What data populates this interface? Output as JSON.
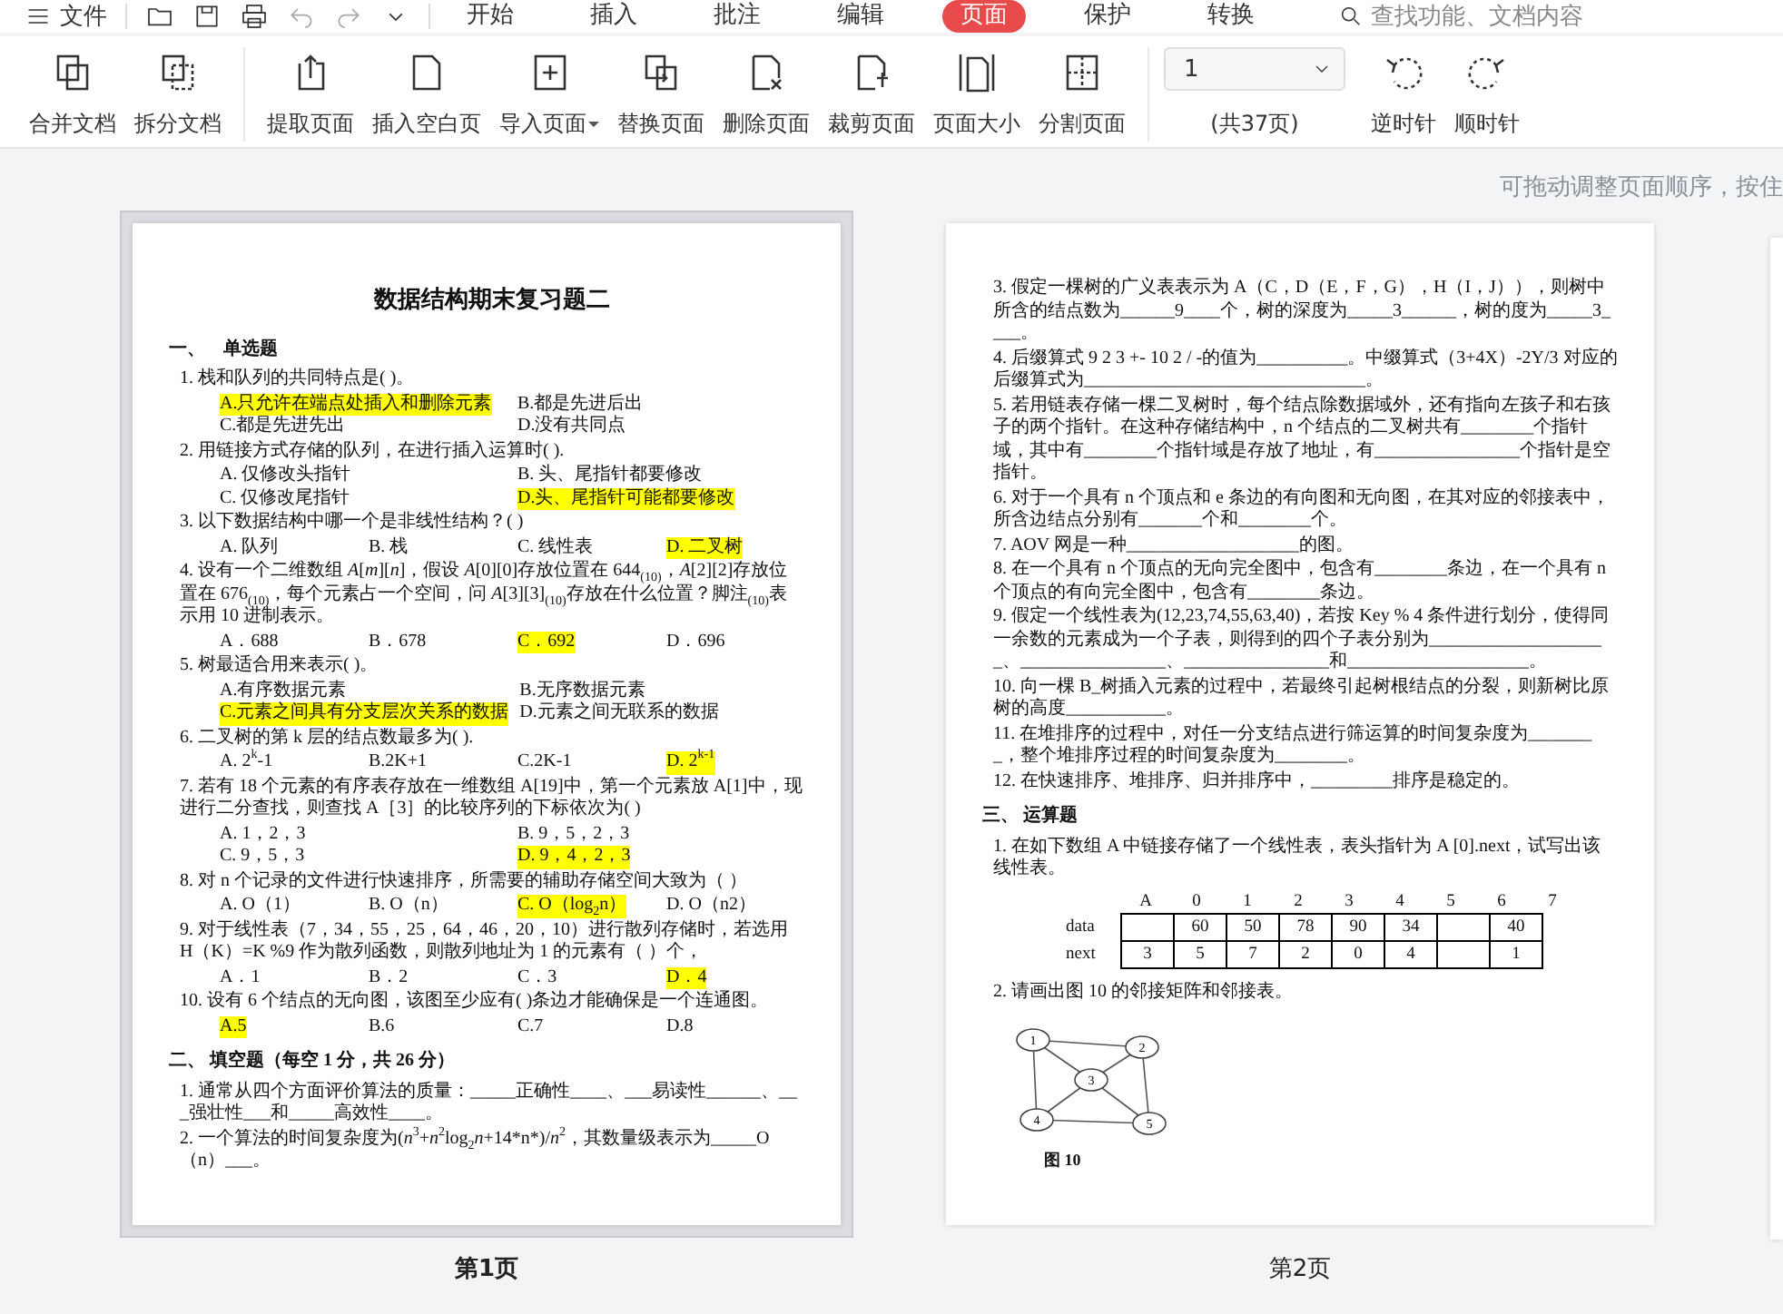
{
  "menu": {
    "label": "文件"
  },
  "tabs": [
    {
      "label": "开始",
      "selected": false
    },
    {
      "label": "插入",
      "selected": false
    },
    {
      "label": "批注",
      "selected": false
    },
    {
      "label": "编辑",
      "selected": false
    },
    {
      "label": "页面",
      "selected": true
    },
    {
      "label": "保护",
      "selected": false
    },
    {
      "label": "转换",
      "selected": false
    }
  ],
  "search": {
    "placeholder": "查找功能、文档内容"
  },
  "toolbar": {
    "groups": [
      [
        {
          "label": "合并文档",
          "dropdown": false
        },
        {
          "label": "拆分文档",
          "dropdown": false
        }
      ],
      [
        {
          "label": "提取页面",
          "dropdown": false
        },
        {
          "label": "插入空白页",
          "dropdown": false
        },
        {
          "label": "导入页面",
          "dropdown": true
        },
        {
          "label": "替换页面",
          "dropdown": false
        },
        {
          "label": "删除页面",
          "dropdown": false
        },
        {
          "label": "裁剪页面",
          "dropdown": false
        },
        {
          "label": "页面大小",
          "dropdown": false
        },
        {
          "label": "分割页面",
          "dropdown": false
        }
      ]
    ],
    "page_select": {
      "value": "1",
      "total": "(共37页)"
    },
    "rotate": [
      {
        "label": "逆时针"
      },
      {
        "label": "顺时针"
      }
    ]
  },
  "hint": "可拖动调整页面顺序，按住",
  "pages": [
    {
      "label": "第1页",
      "selected": true,
      "content": [
        {
          "kind": "title",
          "text": "数据结构期末复习题二"
        },
        {
          "kind": "section",
          "text": "一、　单选题"
        },
        {
          "kind": "question",
          "text": "1.  栈和队列的共同特点是(          )。"
        },
        {
          "kind": "options",
          "options": [
            {
              "text": "A.只允许在端点处插入和删除元素",
              "highlighted": true
            },
            {
              "text": "B.都是先进后出",
              "highlighted": false
            },
            {
              "text": "C.都是先进先出",
              "highlighted": false
            },
            {
              "text": "D.没有共同点",
              "highlighted": false
            }
          ]
        },
        {
          "kind": "question",
          "text": "2.  用链接方式存储的队列，在进行插入运算时(    )."
        },
        {
          "kind": "options",
          "options": [
            {
              "text": "A. 仅修改头指针",
              "highlighted": false
            },
            {
              "text": "B. 头、尾指针都要修改",
              "highlighted": false
            },
            {
              "text": "C. 仅修改尾指针",
              "highlighted": false
            },
            {
              "text": "D.头、尾指针可能都要修改",
              "highlighted": true
            }
          ]
        },
        {
          "kind": "question",
          "text": "3.  以下数据结构中哪一个是非线性结构？(     )"
        },
        {
          "kind": "options4",
          "options": [
            {
              "text": "A. 队列",
              "highlighted": false
            },
            {
              "text": "B. 栈",
              "highlighted": false
            },
            {
              "text": "C. 线性表",
              "highlighted": false
            },
            {
              "text": "D. 二叉树",
              "highlighted": true
            }
          ]
        },
        {
          "kind": "question",
          "text": "4.  设有一个二维数组 *A*[*m*][*n*]，假设 *A*[0][0]存放位置在 644$_{(10)}$，*A*[2][2]存放位置在 676$_{(10)}$，每个元素占一个空间，问 *A*[3][3]$_{(10)}$存放在什么位置？脚注$_{(10)}$表示用 10 进制表示。"
        },
        {
          "kind": "options4",
          "options": [
            {
              "text": "A．688",
              "highlighted": false
            },
            {
              "text": "B．678",
              "highlighted": false
            },
            {
              "text": "C．692",
              "highlighted": true
            },
            {
              "text": "D．696",
              "highlighted": false
            }
          ]
        },
        {
          "kind": "question",
          "text": "5.  树最适合用来表示(          )。"
        },
        {
          "kind": "options",
          "options": [
            {
              "text": "A.有序数据元素",
              "highlighted": false
            },
            {
              "text": "B.无序数据元素",
              "highlighted": false
            },
            {
              "text": "C.元素之间具有分支层次关系的数据",
              "highlighted": true
            },
            {
              "text": "D.元素之间无联系的数据",
              "highlighted": false
            }
          ]
        },
        {
          "kind": "question",
          "text": "6.  二叉树的第 k 层的结点数最多为(    )."
        },
        {
          "kind": "options4",
          "options": [
            {
              "text": "A.  2$^{k}$-1",
              "highlighted": false
            },
            {
              "text": "B.2K+1",
              "highlighted": false
            },
            {
              "text": "C.2K-1",
              "highlighted": false
            },
            {
              "text": "D. 2$^{k-1}$",
              "highlighted": true
            }
          ]
        },
        {
          "kind": "question",
          "text": "7.  若有 18 个元素的有序表存放在一维数组 A[19]中，第一个元素放 A[1]中，现进行二分查找，则查找 A［3］的比较序列的下标依次为(          )"
        },
        {
          "kind": "options",
          "options": [
            {
              "text": "A. 1，2，3",
              "highlighted": false
            },
            {
              "text": "B. 9，5，2，3",
              "highlighted": false
            },
            {
              "text": "C. 9，5，3",
              "highlighted": false
            },
            {
              "text": "D. 9，4，2，3",
              "highlighted": true
            }
          ]
        },
        {
          "kind": "question",
          "text": "8.  对 n 个记录的文件进行快速排序，所需要的辅助存储空间大致为（          ）"
        },
        {
          "kind": "options4",
          "options": [
            {
              "text": "A. O（1）",
              "highlighted": false
            },
            {
              "text": "B. O（n）",
              "highlighted": false
            },
            {
              "text": "C. O（log$_{2}$n）",
              "highlighted": true
            },
            {
              "text": "D. O（n2）",
              "highlighted": false
            }
          ]
        },
        {
          "kind": "question",
          "text": "9.  对于线性表（7，34，55，25，64，46，20，10）进行散列存储时，若选用 H（K）=K %9 作为散列函数，则散列地址为 1 的元素有（     ）个，"
        },
        {
          "kind": "options4",
          "options": [
            {
              "text": "A．1",
              "highlighted": false
            },
            {
              "text": "B．2",
              "highlighted": false
            },
            {
              "text": "C．3",
              "highlighted": false
            },
            {
              "text": "D．4",
              "highlighted": true
            }
          ]
        },
        {
          "kind": "question",
          "text": "10. 设有 6 个结点的无向图，该图至少应有(          )条边才能确保是一个连通图。"
        },
        {
          "kind": "options4",
          "options": [
            {
              "text": "A.5",
              "highlighted": true
            },
            {
              "text": "B.6",
              "highlighted": false
            },
            {
              "text": "C.7",
              "highlighted": false
            },
            {
              "text": "D.8",
              "highlighted": false
            }
          ]
        },
        {
          "kind": "section",
          "text": "二、 填空题（每空 1 分，共 26 分）"
        },
        {
          "kind": "question",
          "text": "1.  通常从四个方面评价算法的质量：_____正确性____、___易读性______、___强壮性___和_____高效性____。"
        },
        {
          "kind": "question",
          "text": "2.  一个算法的时间复杂度为(*n*$^{3}$+*n*$^{2}$log$_{2}$*n*+14*n*)/*n*$^{2}$，其数量级表示为_____O（n）___。"
        }
      ]
    },
    {
      "label": "第2页",
      "selected": false,
      "content": [
        {
          "kind": "question",
          "text": "3.  假定一棵树的广义表表示为 A（C，D（E，F，G），H（I，J）），则树中所含的结点数为______9____个，树的深度为_____3______，树的度为_____3____。"
        },
        {
          "kind": "question",
          "text": "4.  后缀算式 9 2 3 +- 10 2 / -的值为__________。中缀算式（3+4X）-2Y/3 对应的后缀算式为_______________________________。"
        },
        {
          "kind": "question",
          "text": "5.  若用链表存储一棵二叉树时，每个结点除数据域外，还有指向左孩子和右孩子的两个指针。在这种存储结构中，n 个结点的二叉树共有________个指针域，其中有________个指针域是存放了地址，有________________个指针是空指针。"
        },
        {
          "kind": "question",
          "text": "6.  对于一个具有 n 个顶点和 e 条边的有向图和无向图，在其对应的邻接表中，所含边结点分别有_______个和________个。"
        },
        {
          "kind": "question",
          "text": "7.  AOV 网是一种___________________的图。"
        },
        {
          "kind": "question",
          "text": "8.  在一个具有 n 个顶点的无向完全图中，包含有________条边，在一个具有 n 个顶点的有向完全图中，包含有________条边。"
        },
        {
          "kind": "question",
          "text": "9.  假定一个线性表为(12,23,74,55,63,40)，若按 Key % 4 条件进行划分，使得同一余数的元素成为一个子表，则得到的四个子表分别为____________________、________________、________________和____________________。"
        },
        {
          "kind": "question",
          "text": "10. 向一棵 B_树插入元素的过程中，若最终引起树根结点的分裂，则新树比原树的高度___________。"
        },
        {
          "kind": "question",
          "text": "11. 在堆排序的过程中，对任一分支结点进行筛运算的时间复杂度为________，整个堆排序过程的时间复杂度为________。"
        },
        {
          "kind": "question",
          "text": "12. 在快速排序、堆排序、归并排序中，_________排序是稳定的。"
        },
        {
          "kind": "section",
          "text": "三、 运算题"
        },
        {
          "kind": "question",
          "text": "1.  在如下数组 A 中链接存储了一个线性表，表头指针为 A [0].next，试写出该线性表。"
        },
        {
          "kind": "table",
          "header": [
            "A",
            "0",
            "1",
            "2",
            "3",
            "4",
            "5",
            "6",
            "7"
          ],
          "rows": [
            {
              "label": "data",
              "cells": [
                null,
                "60",
                "50",
                "78",
                "90",
                "34",
                null,
                "40"
              ]
            },
            {
              "label": "next",
              "cells": [
                "3",
                "5",
                "7",
                "2",
                "0",
                "4",
                null,
                "1"
              ]
            }
          ]
        },
        {
          "kind": "question",
          "text": "2.  请画出图 10 的邻接矩阵和邻接表。"
        },
        {
          "kind": "figure",
          "nodes": [
            "1",
            "2",
            "3",
            "4",
            "5"
          ],
          "caption": "图 10"
        }
      ]
    }
  ]
}
